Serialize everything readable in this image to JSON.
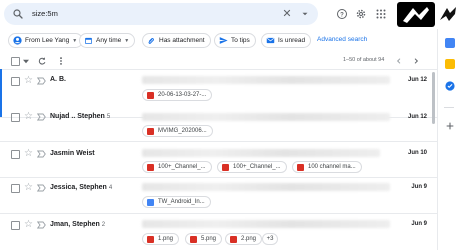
{
  "search": {
    "query": "size:5m",
    "clear": "✕"
  },
  "topbar": {
    "icons": [
      "search-icon",
      "help-icon",
      "settings-icon",
      "apps-icon"
    ]
  },
  "chips": [
    {
      "label": "From Lee Yang",
      "icon": "person-icon",
      "dropdown": true
    },
    {
      "label": "Any time",
      "icon": "calendar-icon",
      "dropdown": true
    },
    {
      "label": "Has attachment",
      "icon": "attachment-icon",
      "dropdown": false
    },
    {
      "label": "To tips",
      "icon": "send-icon",
      "dropdown": false
    },
    {
      "label": "Is unread",
      "icon": "mail-icon",
      "dropdown": false
    }
  ],
  "advanced_search": "Advanced search",
  "pagination": {
    "range": "1–50 of about 94"
  },
  "emails": [
    {
      "sender": "A. B.",
      "count": "",
      "date": "Jun 12",
      "attachments": [
        {
          "name": "20-06-13-03-27-...",
          "type": "pdf"
        }
      ],
      "more": ""
    },
    {
      "sender": "Nujad .. Stephen",
      "count": "5",
      "date": "Jun 12",
      "attachments": [
        {
          "name": "MVIMG_202006...",
          "type": "image"
        }
      ],
      "more": ""
    },
    {
      "sender": "Jasmin Weist",
      "count": "",
      "date": "Jun 10",
      "attachments": [
        {
          "name": "100+_Channel_...",
          "type": "image"
        },
        {
          "name": "100+_Channel_...",
          "type": "image"
        },
        {
          "name": "100 channel ma...",
          "type": "image"
        }
      ],
      "more": ""
    },
    {
      "sender": "Jessica, Stephen",
      "count": "4",
      "date": "Jun 9",
      "attachments": [],
      "more": ""
    },
    {
      "sender": "Jman, Stephen",
      "count": "2",
      "date": "Jun 9",
      "attachments": [
        {
          "name": "1.png",
          "type": "image"
        },
        {
          "name": "5.png",
          "type": "image"
        },
        {
          "name": "2.png",
          "type": "image"
        }
      ],
      "more": "+3"
    }
  ],
  "extra_attachment": {
    "name": "TW_Android_In...",
    "type": "doc"
  },
  "colors": {
    "accent": "#1a73e8",
    "pdf": "#d93025",
    "image": "#d93025",
    "doc": "#4285f4"
  }
}
